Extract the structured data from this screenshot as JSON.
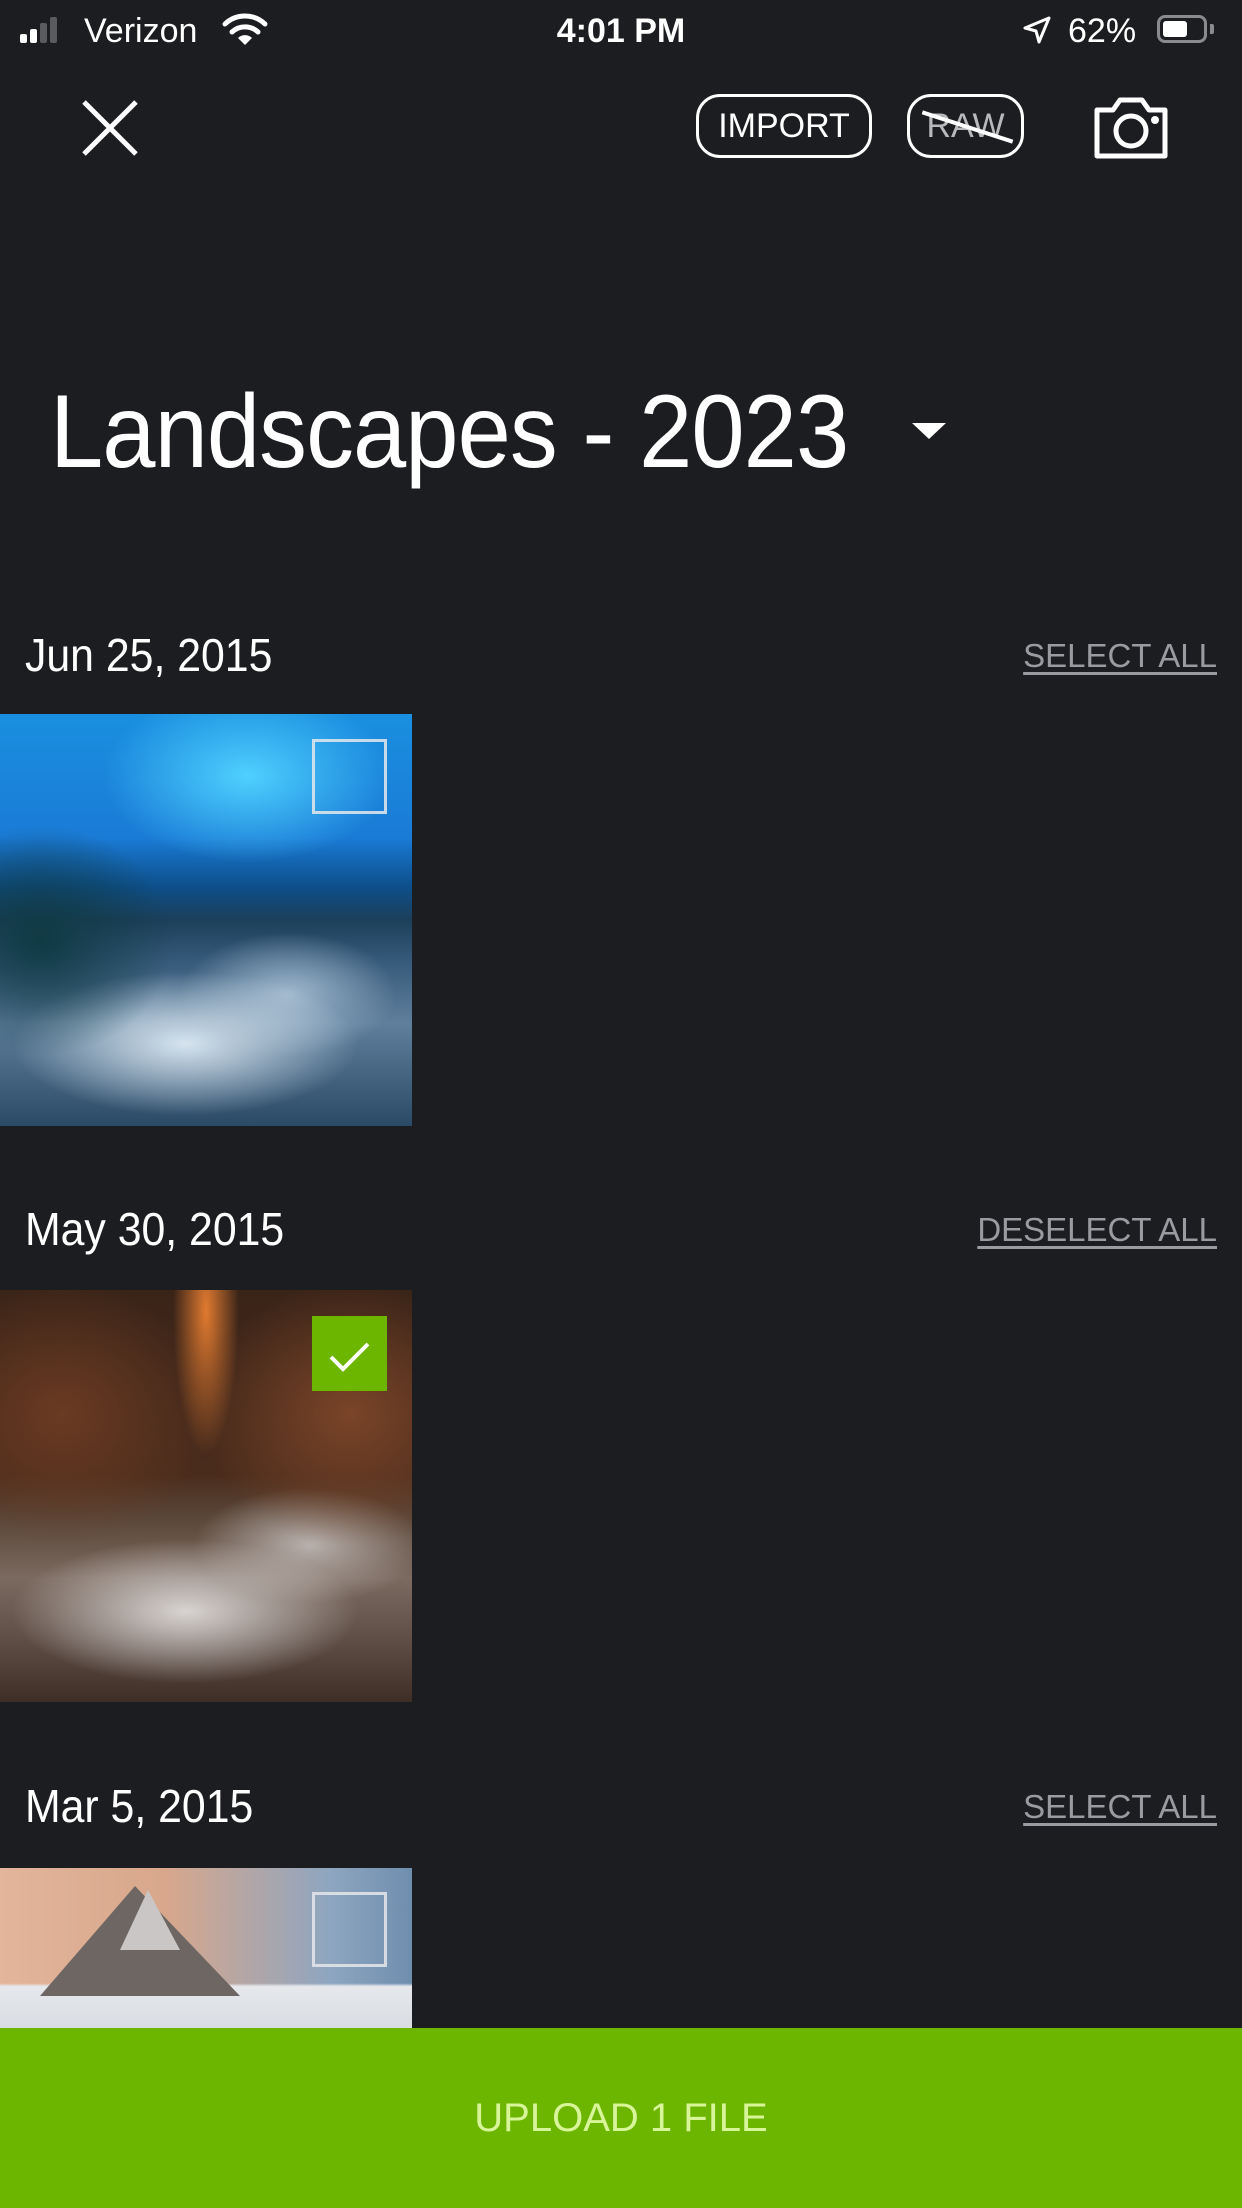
{
  "status_bar": {
    "carrier": "Verizon",
    "signal_bars_active": 2,
    "signal_bars_total": 4,
    "time": "4:01 PM",
    "battery_percent_label": "62%",
    "battery_level": 0.62,
    "icons": [
      "signal-icon",
      "wifi-icon",
      "location-arrow-icon",
      "battery-icon"
    ]
  },
  "toolbar": {
    "close_icon": "close-icon",
    "import_label": "IMPORT",
    "raw_label": "RAW",
    "raw_enabled": false,
    "camera_icon": "camera-icon"
  },
  "album": {
    "title": "Landscapes - 2023",
    "dropdown_icon": "caret-down-icon"
  },
  "groups": [
    {
      "date": "Jun 25, 2015",
      "action_label": "SELECT ALL",
      "photos": [
        {
          "subject": "ice cave river",
          "selected": false
        }
      ]
    },
    {
      "date": "May 30, 2015",
      "action_label": "DESELECT ALL",
      "photos": [
        {
          "subject": "canyon river",
          "selected": true
        }
      ]
    },
    {
      "date": "Mar 5, 2015",
      "action_label": "SELECT ALL",
      "photos": [
        {
          "subject": "snowy mountain",
          "selected": false
        }
      ]
    }
  ],
  "upload": {
    "label": "UPLOAD 1 FILE"
  },
  "colors": {
    "background": "#1c1d21",
    "accent_green": "#6db600",
    "upload_text": "#d9f59a",
    "secondary_text": "#9a9ba0"
  }
}
